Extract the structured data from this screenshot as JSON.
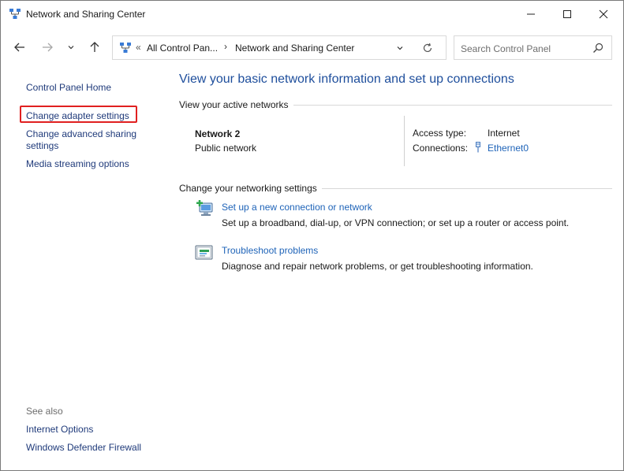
{
  "window": {
    "title": "Network and Sharing Center"
  },
  "address": {
    "overflow": "«",
    "segments": [
      "All Control Pan...",
      "Network and Sharing Center"
    ],
    "search_placeholder": "Search Control Panel"
  },
  "left_pane": {
    "home": "Control Panel Home",
    "links": [
      "Change adapter settings",
      "Change advanced sharing settings",
      "Media streaming options"
    ],
    "see_also_label": "See also",
    "see_also": [
      "Internet Options",
      "Windows Defender Firewall"
    ]
  },
  "main": {
    "title": "View your basic network information and set up connections",
    "active_networks_label": "View your active networks",
    "network": {
      "name": "Network 2",
      "type": "Public network",
      "access_type_label": "Access type:",
      "access_type_value": "Internet",
      "connections_label": "Connections:",
      "connections_value": "Ethernet0"
    },
    "change_settings_label": "Change your networking settings",
    "tasks": [
      {
        "link": "Set up a new connection or network",
        "desc": "Set up a broadband, dial-up, or VPN connection; or set up a router or access point.",
        "icon": "new-connection-icon"
      },
      {
        "link": "Troubleshoot problems",
        "desc": "Diagnose and repair network problems, or get troubleshooting information.",
        "icon": "troubleshoot-icon"
      }
    ]
  },
  "colors": {
    "link": "#1e63b8",
    "title": "#1e4e9c",
    "highlight": "#e02020"
  }
}
